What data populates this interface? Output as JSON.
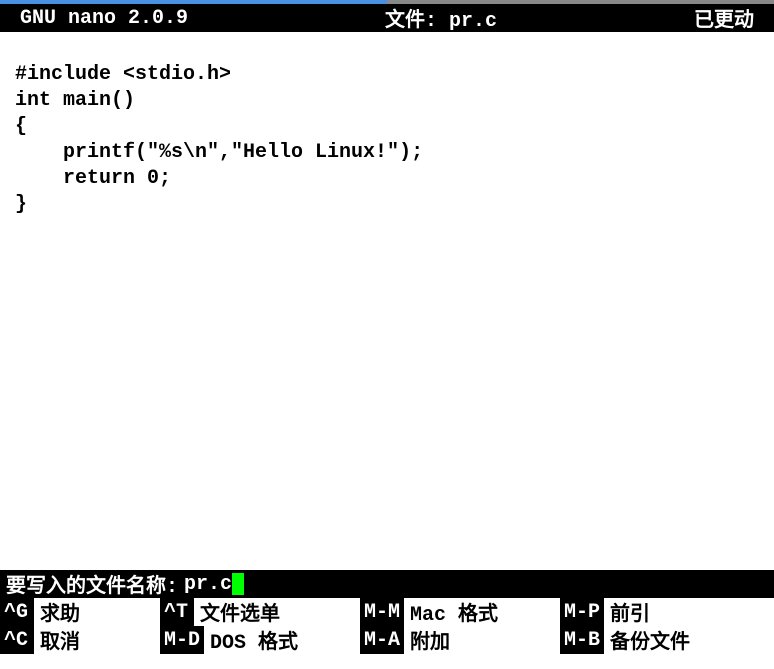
{
  "title_bar": {
    "app": "GNU nano 2.0.9",
    "file_label": "文件: pr.c",
    "status": "已更动"
  },
  "editor": {
    "content": "#include <stdio.h>\nint main()\n{\n    printf(\"%s\\n\",\"Hello Linux!\");\n    return 0;\n}"
  },
  "prompt": {
    "label": "要写入的文件名称:",
    "value": "pr.c"
  },
  "shortcuts": {
    "row1": [
      {
        "key": "^G",
        "label": "求助"
      },
      {
        "key": "^T",
        "label": "文件选单"
      },
      {
        "key": "M-M",
        "label": "Mac 格式"
      },
      {
        "key": "M-P",
        "label": "前引"
      }
    ],
    "row2": [
      {
        "key": "^C",
        "label": "取消"
      },
      {
        "key": "M-D",
        "label": "DOS 格式"
      },
      {
        "key": "M-A",
        "label": "附加"
      },
      {
        "key": "M-B",
        "label": "备份文件"
      }
    ]
  }
}
